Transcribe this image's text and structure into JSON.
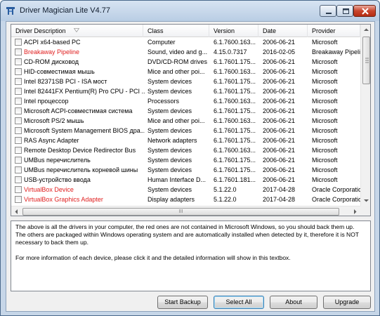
{
  "window": {
    "title": "Driver Magician Lite V4.77"
  },
  "listview": {
    "columns": [
      "Driver Description",
      "Class",
      "Version",
      "Date",
      "Provider"
    ],
    "rows": [
      {
        "desc": "ACPI x64-based PC",
        "class": "Computer",
        "version": "6.1.7600.163...",
        "date": "2006-06-21",
        "provider": "Microsoft",
        "non_ms": false
      },
      {
        "desc": "Breakaway Pipeline",
        "class": "Sound, video and g...",
        "version": "4.15.0.7317",
        "date": "2016-02-05",
        "provider": "Breakaway Pipelin",
        "non_ms": true
      },
      {
        "desc": "CD-ROM дисковод",
        "class": "DVD/CD-ROM drives",
        "version": "6.1.7601.175...",
        "date": "2006-06-21",
        "provider": "Microsoft",
        "non_ms": false
      },
      {
        "desc": "HID-совместимая мышь",
        "class": "Mice and other poi...",
        "version": "6.1.7600.163...",
        "date": "2006-06-21",
        "provider": "Microsoft",
        "non_ms": false
      },
      {
        "desc": "Intel 82371SB PCI - ISA мост",
        "class": "System devices",
        "version": "6.1.7601.175...",
        "date": "2006-06-21",
        "provider": "Microsoft",
        "non_ms": false
      },
      {
        "desc": "Intel 82441FX Pentium(R) Pro CPU - PCI ...",
        "class": "System devices",
        "version": "6.1.7601.175...",
        "date": "2006-06-21",
        "provider": "Microsoft",
        "non_ms": false
      },
      {
        "desc": "Intel процессор",
        "class": "Processors",
        "version": "6.1.7600.163...",
        "date": "2006-06-21",
        "provider": "Microsoft",
        "non_ms": false
      },
      {
        "desc": "Microsoft ACPI-совместимая система",
        "class": "System devices",
        "version": "6.1.7601.175...",
        "date": "2006-06-21",
        "provider": "Microsoft",
        "non_ms": false
      },
      {
        "desc": "Microsoft PS/2 мышь",
        "class": "Mice and other poi...",
        "version": "6.1.7600.163...",
        "date": "2006-06-21",
        "provider": "Microsoft",
        "non_ms": false
      },
      {
        "desc": "Microsoft System Management BIOS дра...",
        "class": "System devices",
        "version": "6.1.7601.175...",
        "date": "2006-06-21",
        "provider": "Microsoft",
        "non_ms": false
      },
      {
        "desc": "RAS Async Adapter",
        "class": "Network adapters",
        "version": "6.1.7601.175...",
        "date": "2006-06-21",
        "provider": "Microsoft",
        "non_ms": false
      },
      {
        "desc": "Remote Desktop Device Redirector Bus",
        "class": "System devices",
        "version": "6.1.7600.163...",
        "date": "2006-06-21",
        "provider": "Microsoft",
        "non_ms": false
      },
      {
        "desc": "UMBus перечислитель",
        "class": "System devices",
        "version": "6.1.7601.175...",
        "date": "2006-06-21",
        "provider": "Microsoft",
        "non_ms": false
      },
      {
        "desc": "UMBus перечислитель корневой шины",
        "class": "System devices",
        "version": "6.1.7601.175...",
        "date": "2006-06-21",
        "provider": "Microsoft",
        "non_ms": false
      },
      {
        "desc": "USB-устройство ввода",
        "class": "Human Interface D...",
        "version": "6.1.7601.181...",
        "date": "2006-06-21",
        "provider": "Microsoft",
        "non_ms": false
      },
      {
        "desc": "VirtualBox Device",
        "class": "System devices",
        "version": "5.1.22.0",
        "date": "2017-04-28",
        "provider": "Oracle Corporation",
        "non_ms": true
      },
      {
        "desc": "VirtualBox Graphics Adapter",
        "class": "Display adapters",
        "version": "5.1.22.0",
        "date": "2017-04-28",
        "provider": "Oracle Corporation",
        "non_ms": true
      }
    ],
    "hscroll_label": "III"
  },
  "info": {
    "line1": "The above is all the drivers in your computer, the red ones are not contained in Microsoft Windows, so you should back them up.",
    "line2": "The others are packaged within Windows operating system and are automatically installed when detected by it, therefore it is NOT necessary to back them up.",
    "line3": "For more information of each device, please click it and the detailed information will show in this textbox."
  },
  "buttons": {
    "start_backup": "Start Backup",
    "select_all": "Select All",
    "about": "About",
    "upgrade": "Upgrade"
  },
  "colors": {
    "non_ms_text": "#e02020",
    "title_bar": "#c6d6e8"
  },
  "icons": {
    "app": "driver-magician-icon",
    "sort": "sort-arrow-icon"
  }
}
